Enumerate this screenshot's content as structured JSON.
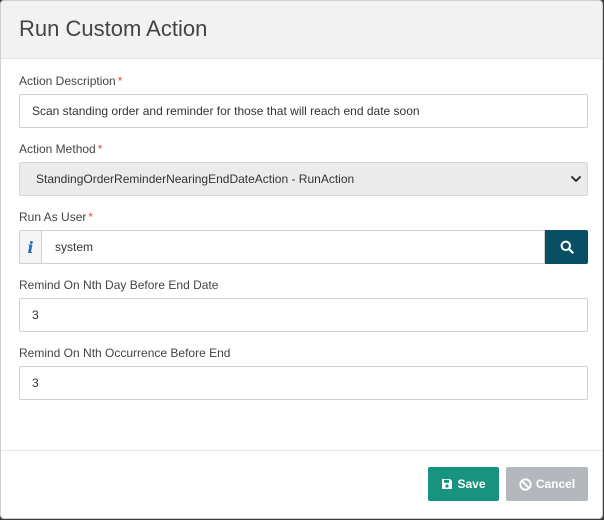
{
  "dialog": {
    "title": "Run Custom Action"
  },
  "required_marker": "*",
  "fields": {
    "action_description": {
      "label": "Action Description",
      "required": true,
      "value": "Scan standing order and reminder for those that will reach end date soon"
    },
    "action_method": {
      "label": "Action Method",
      "required": true,
      "selected": "StandingOrderReminderNearingEndDateAction - RunAction"
    },
    "run_as_user": {
      "label": "Run As User",
      "required": true,
      "addon": "i",
      "value": "system"
    },
    "remind_nth_day": {
      "label": "Remind On Nth Day Before End Date",
      "required": false,
      "value": "3"
    },
    "remind_nth_occurrence": {
      "label": "Remind On Nth Occurrence Before End",
      "required": false,
      "value": "3"
    }
  },
  "footer": {
    "save_label": "Save",
    "cancel_label": "Cancel"
  },
  "icons": {
    "info": "info-icon",
    "search": "search-icon",
    "save": "floppy-disk-icon",
    "cancel": "ban-icon",
    "dropdown": "chevron-down-icon"
  },
  "colors": {
    "primary_dark": "#084f63",
    "save": "#18937f",
    "cancel": "#b4b8bc",
    "required": "#d9534f",
    "header_bg": "#f2f2f2",
    "select_bg": "#ebebeb"
  }
}
